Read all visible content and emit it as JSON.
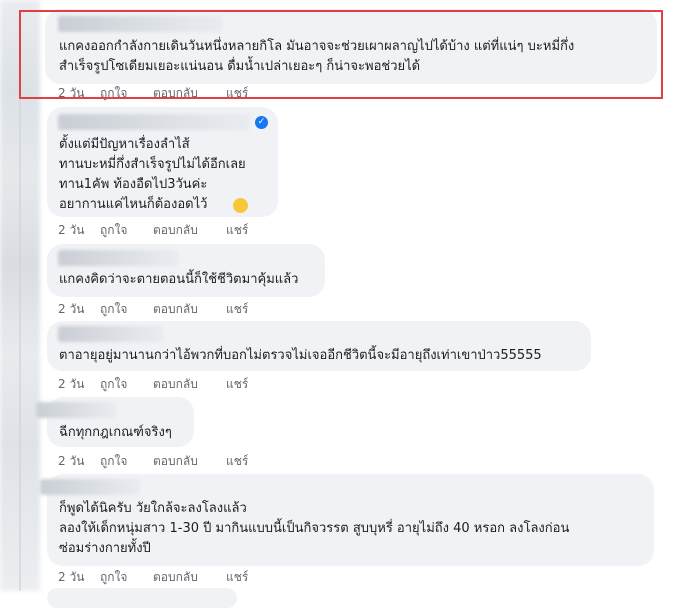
{
  "comments": [
    {
      "lines": [
        "แกคงออกกำลังกายเดินวันหนึ่งหลายกิโล มันอาจจะช่วยเผาผลาญไปได้บ้าง แต่ที่แน่ๆ บะหมี่กึ่ง",
        "สำเร็จรูปโซเดียมเยอะแน่นอน ดื่มน้ำเปล่าเยอะๆ ก็น่าจะพอช่วยได้"
      ],
      "time": "2 วัน",
      "like": "ถูกใจ",
      "reply": "ตอบกลับ",
      "share": "แชร์"
    },
    {
      "lines": [
        "ตั้งแต่มีปัญหาเรื่องลำไส้",
        "ทานบะหมี่กึ่งสำเร็จรูปไม่ได้อีกเลย",
        "ทาน1คัพ ท้องอืดไป3วันค่ะ",
        "อยากานแค่ไหนก็ต้องอดไว้"
      ],
      "time": "2 วัน",
      "like": "ถูกใจ",
      "reply": "ตอบกลับ",
      "share": "แชร์"
    },
    {
      "lines": [
        "แกคงคิดว่าจะตายตอนนี้ก็ใช้ชีวิตมาคุ้มแล้ว"
      ],
      "time": "2 วัน",
      "like": "ถูกใจ",
      "reply": "ตอบกลับ",
      "share": "แชร์"
    },
    {
      "lines": [
        "ตาอายุอยู่มานานกว่าไอ้พวกที่บอกไม่ตรวจไม่เจออีกชีวิตนี้จะมีอายุถึงเท่าเขาป่าว55555"
      ],
      "time": "2 วัน",
      "like": "ถูกใจ",
      "reply": "ตอบกลับ",
      "share": "แชร์"
    },
    {
      "lines": [
        "ฉีกทุกกฎเกณฑ์จริงๆ"
      ],
      "time": "2 วัน",
      "like": "ถูกใจ",
      "reply": "ตอบกลับ",
      "share": "แชร์"
    },
    {
      "lines": [
        "ก็พูดได้นิครับ วัยใกล้จะลงโลงแล้ว",
        "ลองให้เด็กหนุ่มสาว 1-30 ปี มากินแบบนี้เป็นกิจวรรต สูบบุหรี่ อายุไม่ถึง 40 หรอก ลงโลงก่อน",
        "ซ่อมร่างกายทั้งปี"
      ],
      "time": "2 วัน",
      "like": "ถูกใจ",
      "reply": "ตอบกลับ",
      "share": "แชร์"
    }
  ],
  "colors": {
    "bubble": "#f0f2f5",
    "highlight": "#e0403f",
    "verified": "#1877f2"
  },
  "icons": [
    "verified-badge-icon",
    "grinning-emoji-icon"
  ]
}
